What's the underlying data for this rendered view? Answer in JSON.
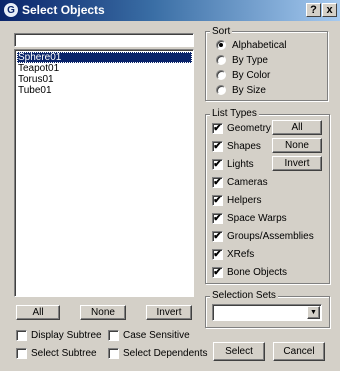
{
  "window": {
    "title": "Select Objects",
    "icon_letter": "G",
    "help_label": "?",
    "close_label": "x"
  },
  "filter": {
    "value": ""
  },
  "objects": [
    "Sphere01",
    "Teapot01",
    "Torus01",
    "Tube01"
  ],
  "list_buttons": {
    "all": "All",
    "none": "None",
    "invert": "Invert"
  },
  "options": {
    "display_subtree": "Display Subtree",
    "case_sensitive": "Case Sensitive",
    "select_subtree": "Select Subtree",
    "select_dependents": "Select Dependents"
  },
  "sort": {
    "title": "Sort",
    "items": [
      "Alphabetical",
      "By Type",
      "By Color",
      "By Size"
    ],
    "selected": "Alphabetical"
  },
  "list_types": {
    "title": "List Types",
    "items": [
      "Geometry",
      "Shapes",
      "Lights",
      "Cameras",
      "Helpers",
      "Space Warps",
      "Groups/Assemblies",
      "XRefs",
      "Bone Objects"
    ],
    "buttons": {
      "all": "All",
      "none": "None",
      "invert": "Invert"
    }
  },
  "selection_sets": {
    "title": "Selection Sets",
    "value": ""
  },
  "actions": {
    "select": "Select",
    "cancel": "Cancel"
  },
  "icons": {
    "check": "✔",
    "dropdown_arrow": "▼"
  }
}
